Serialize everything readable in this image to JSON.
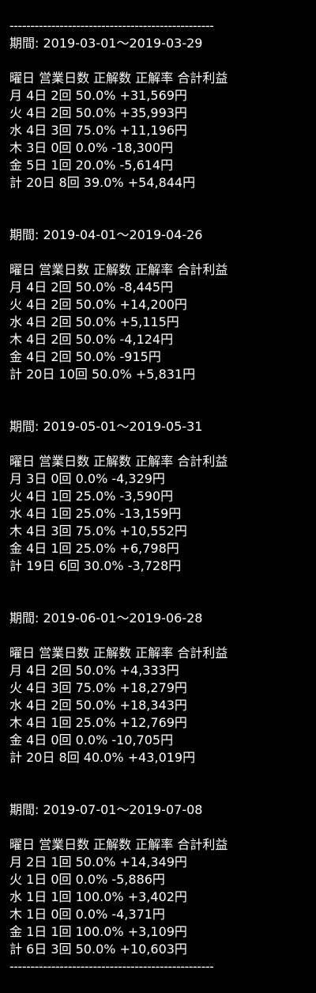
{
  "divider": "-------------------------------------------------",
  "sections": [
    {
      "period": "期間: 2019-03-01～2019-03-29",
      "header": "曜日 営業日数 正解数 正解率 合計利益",
      "rows": [
        "月 4日 2回 50.0% +31,569円",
        "火 4日 2回 50.0% +35,993円",
        "水 4日 3回 75.0% +11,196円",
        "木 3日 0回 0.0% -18,300円",
        "金 5日 1回 20.0% -5,614円",
        "計 20日 8回 39.0% +54,844円"
      ]
    },
    {
      "period": "期間: 2019-04-01～2019-04-26",
      "header": "曜日 営業日数 正解数 正解率 合計利益",
      "rows": [
        "月 4日 2回 50.0% -8,445円",
        "火 4日 2回 50.0% +14,200円",
        "水 4日 2回 50.0% +5,115円",
        "木 4日 2回 50.0% -4,124円",
        "金 4日 2回 50.0% -915円",
        "計 20日 10回 50.0% +5,831円"
      ]
    },
    {
      "period": "期間: 2019-05-01～2019-05-31",
      "header": "曜日 営業日数 正解数 正解率 合計利益",
      "rows": [
        "月 3日 0回 0.0% -4,329円",
        "火 4日 1回 25.0% -3,590円",
        "水 4日 1回 25.0% -13,159円",
        "木 4日 3回 75.0% +10,552円",
        "金 4日 1回 25.0% +6,798円",
        "計 19日 6回 30.0% -3,728円"
      ]
    },
    {
      "period": "期間: 2019-06-01～2019-06-28",
      "header": "曜日 営業日数 正解数 正解率 合計利益",
      "rows": [
        "月 4日 2回 50.0% +4,333円",
        "火 4日 3回 75.0% +18,279円",
        "水 4日 2回 50.0% +18,343円",
        "木 4日 1回 25.0% +12,769円",
        "金 4日 0回 0.0% -10,705円",
        "計 20日 8回 40.0% +43,019円"
      ]
    },
    {
      "period": "期間: 2019-07-01～2019-07-08",
      "header": "曜日 営業日数 正解数 正解率 合計利益",
      "rows": [
        "月 2日 1回 50.0% +14,349円",
        "火 1日 0回 0.0% -5,886円",
        "水 1日 1回 100.0% +3,402円",
        "木 1日 0回 0.0% -4,371円",
        "金 1日 1回 100.0% +3,109円",
        "計 6日 3回 50.0% +10,603円"
      ]
    }
  ]
}
